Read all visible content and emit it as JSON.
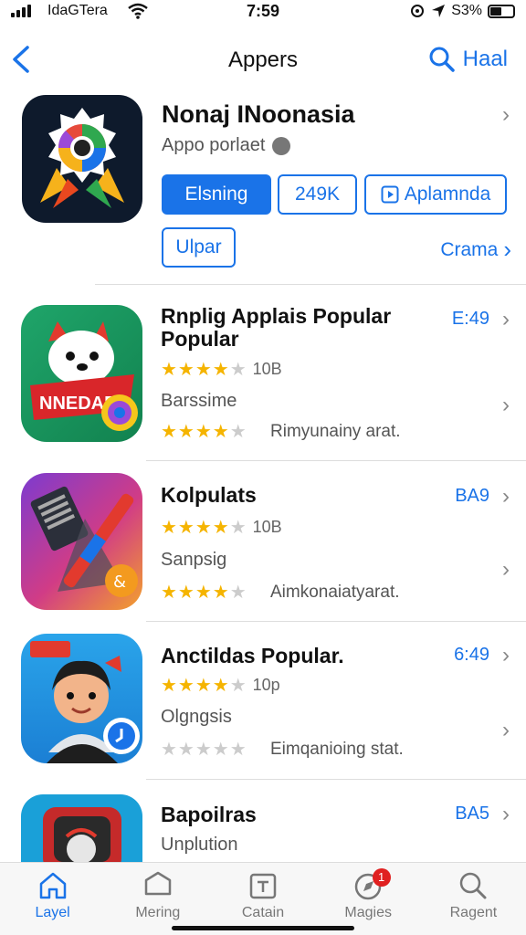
{
  "status": {
    "carrier": "IdaGTera",
    "time": "7:59",
    "battery": "S3%"
  },
  "nav": {
    "title": "Appers",
    "search_label": "Haal"
  },
  "featured": {
    "title": "Nonaj INoonasia",
    "subtitle": "Appo porlaet",
    "buttons": [
      "Elsning",
      "249K",
      "Aplamnda"
    ],
    "secondary_button": "Ulpar",
    "more_link": "Crama"
  },
  "rows": [
    {
      "title": "Rnplig Applais Popular Popular",
      "price": "E:49",
      "rating_count": "10B",
      "subtitle": "Barssime",
      "extra": "Rimyunainy arat."
    },
    {
      "title": "Kolpulats",
      "price": "BA9",
      "rating_count": "10B",
      "subtitle": "Sanpsig",
      "extra": "Aimkonaiatyarat."
    },
    {
      "title": "Anctildas Popular.",
      "price": "6:49",
      "rating_count": "10p",
      "subtitle": "Olgngsis",
      "extra": "Eimqanioing stat."
    },
    {
      "title": "Bapoilras",
      "price": "BA5",
      "subtitle": "Unplution"
    }
  ],
  "tabs": [
    {
      "label": "Layel",
      "icon": "home-icon",
      "active": true
    },
    {
      "label": "Mering",
      "icon": "hexagon-icon",
      "active": false
    },
    {
      "label": "Catain",
      "icon": "calendar-icon",
      "active": false
    },
    {
      "label": "Magies",
      "icon": "compass-icon",
      "active": false,
      "badge": "1"
    },
    {
      "label": "Ragent",
      "icon": "search-icon",
      "active": false
    }
  ],
  "colors": {
    "accent": "#1a73e8",
    "star": "#f5b400",
    "badge": "#e02020"
  }
}
